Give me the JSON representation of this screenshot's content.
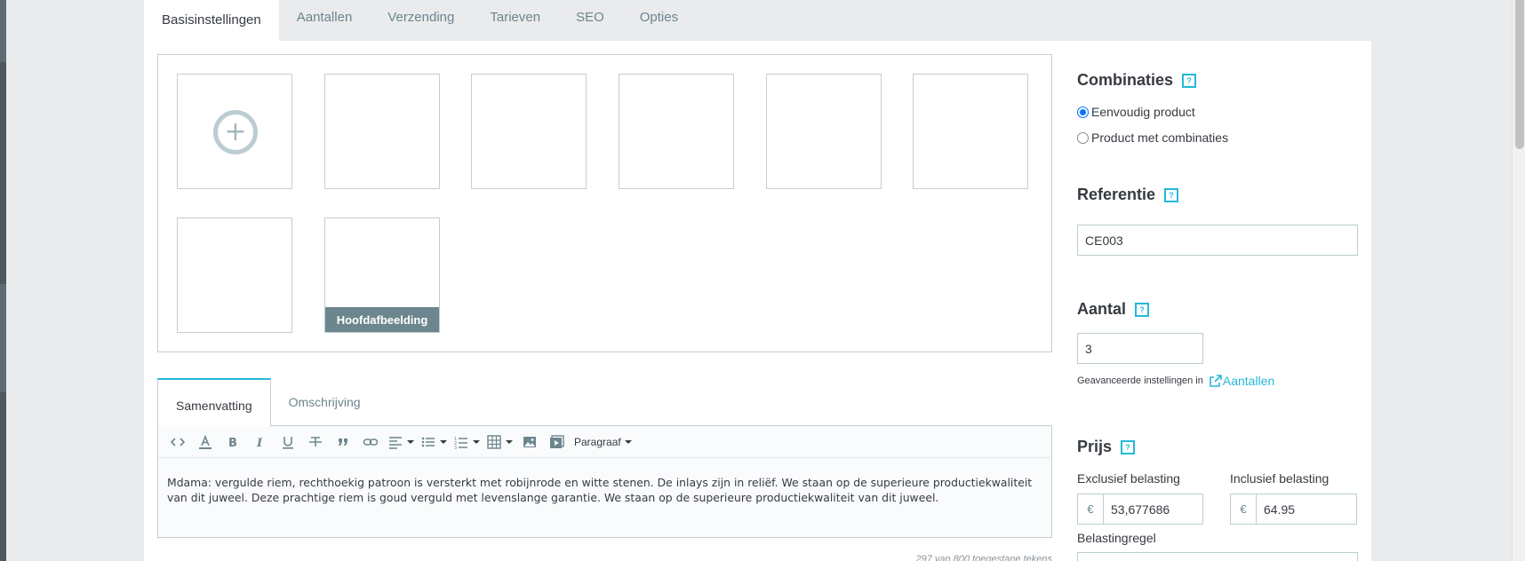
{
  "tabs": [
    {
      "label": "Basisinstellingen"
    },
    {
      "label": "Aantallen"
    },
    {
      "label": "Verzending"
    },
    {
      "label": "Tarieven"
    },
    {
      "label": "SEO"
    },
    {
      "label": "Opties"
    }
  ],
  "images": {
    "add_symbol": "+",
    "cover_label": "Hoofdafbeelding"
  },
  "editor": {
    "tabs": [
      {
        "label": "Samenvatting"
      },
      {
        "label": "Omschrijving"
      }
    ],
    "format_label": "Paragraaf",
    "text": "Mdama: vergulde riem, rechthoekig patroon is versterkt met robijnrode en witte stenen. De inlays zijn in reliëf. We staan op de superieure productiekwaliteit van dit juweel. Deze prachtige riem is  goud verguld met levenslange garantie. We staan op de superieure productiekwaliteit van dit juweel.",
    "char_count": "297 van 800 toegestane tekens"
  },
  "combinations": {
    "title": "Combinaties",
    "help": "?",
    "options": [
      {
        "label": "Eenvoudig product",
        "checked": true
      },
      {
        "label": "Product met combinaties",
        "checked": false
      }
    ]
  },
  "reference": {
    "title": "Referentie",
    "help": "?",
    "value": "CE003"
  },
  "quantity": {
    "title": "Aantal",
    "help": "?",
    "value": "3",
    "hint": "Geavanceerde instellingen in",
    "link": "Aantallen"
  },
  "price": {
    "title": "Prijs",
    "help": "?",
    "excl_label": "Exclusief belasting",
    "incl_label": "Inclusief belasting",
    "currency": "€",
    "excl_value": "53,677686",
    "incl_value": "64.95",
    "tax_rule_label": "Belastingregel"
  },
  "colors": {
    "accent": "#25b9d7",
    "cover_bg": "#6c868e",
    "border": "#bbcdd2"
  }
}
